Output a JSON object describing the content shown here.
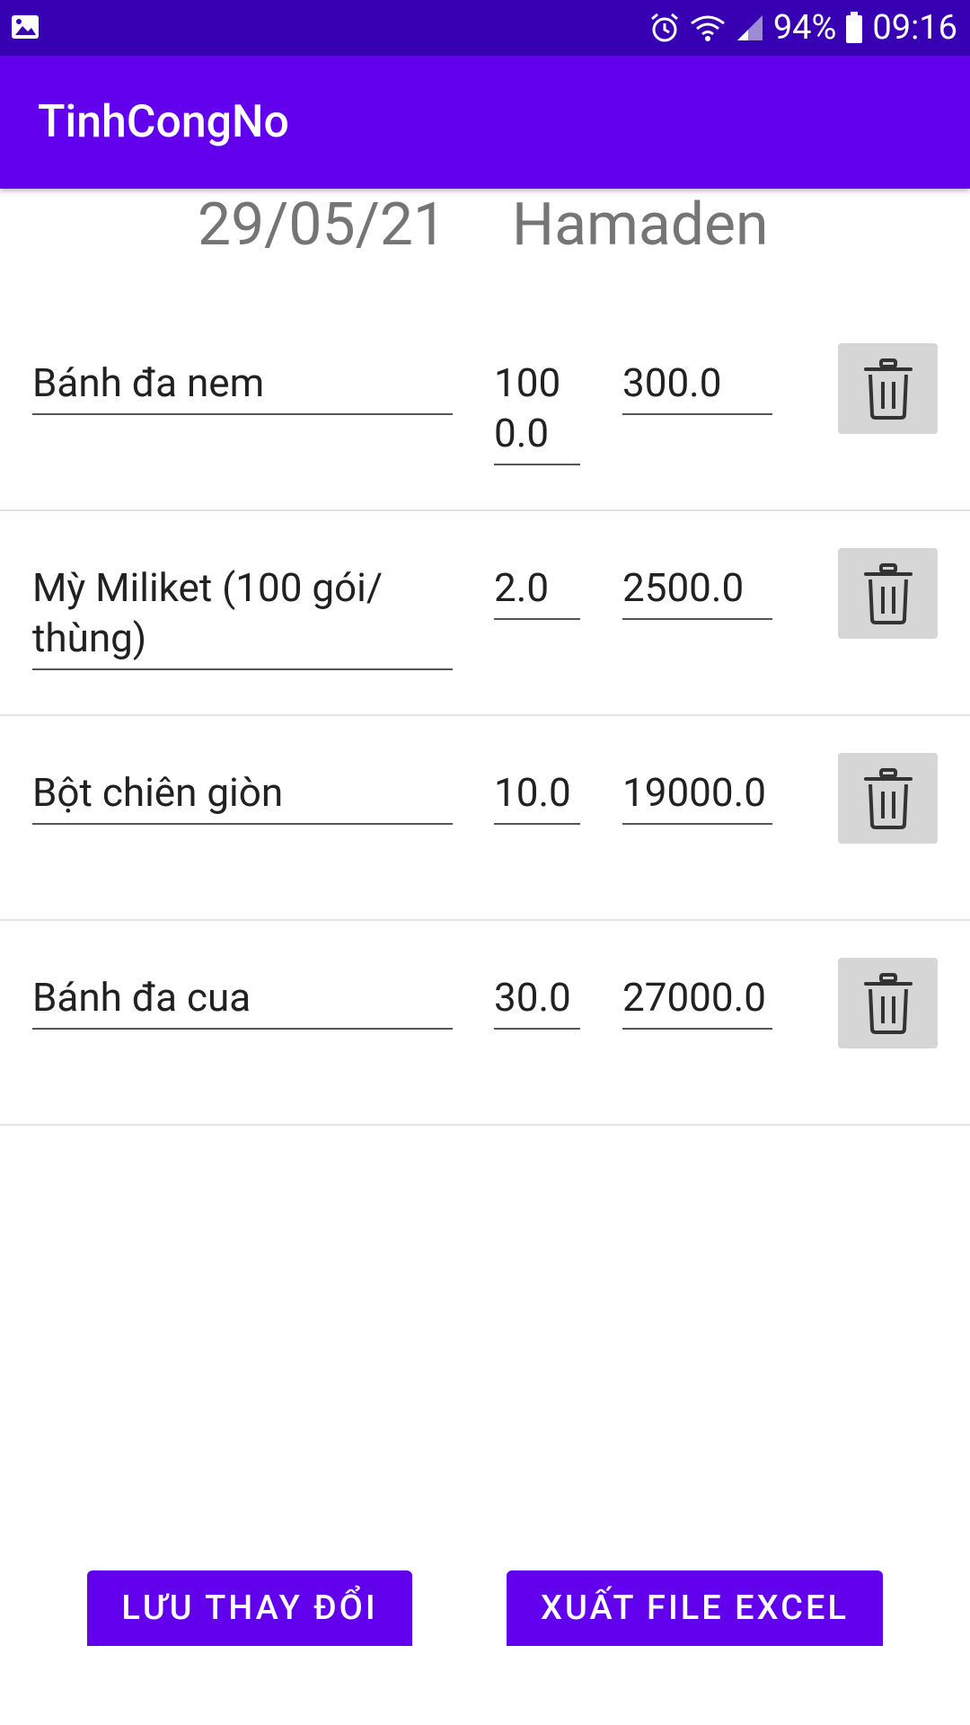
{
  "status_bar": {
    "left_icon": "image-icon",
    "battery": "94%",
    "time": "09:16",
    "icons": [
      "alarm-icon",
      "wifi-icon",
      "signal-icon",
      "battery-icon"
    ]
  },
  "app_bar": {
    "title": "TinhCongNo"
  },
  "header": {
    "date": "29/05/21",
    "supplier": "Hamaden"
  },
  "items": [
    {
      "name": "Bánh đa nem",
      "quantity": "1000.0",
      "price": "300.0"
    },
    {
      "name": "Mỳ Miliket (100 gói/ thùng)",
      "quantity": "2.0",
      "price": "2500.0"
    },
    {
      "name": "Bột chiên giòn",
      "quantity": "10.0",
      "price": "19000.0"
    },
    {
      "name": "Bánh đa cua",
      "quantity": "30.0",
      "price": "27000.0"
    }
  ],
  "actions": {
    "save_label": "LƯU THAY ĐỔI",
    "export_label": "XUẤT FILE EXCEL"
  },
  "colors": {
    "status_bar": "#3700B3",
    "primary": "#6200EE",
    "delete_button_bg": "#D6D6D6"
  }
}
